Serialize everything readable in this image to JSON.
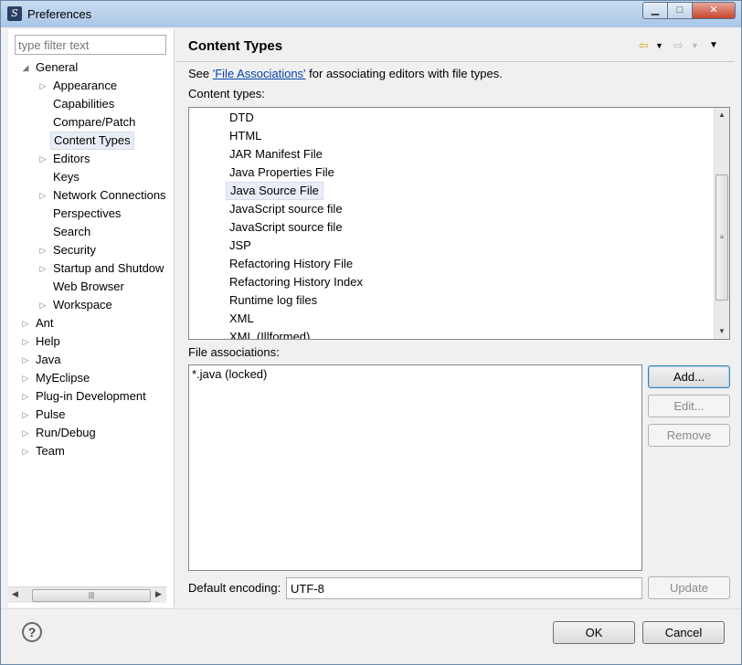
{
  "window": {
    "title": "Preferences"
  },
  "filter": {
    "placeholder": "type filter text"
  },
  "tree": [
    {
      "label": "General",
      "depth": 0,
      "expanded": true
    },
    {
      "label": "Appearance",
      "depth": 1,
      "hasChildren": true
    },
    {
      "label": "Capabilities",
      "depth": 1
    },
    {
      "label": "Compare/Patch",
      "depth": 1
    },
    {
      "label": "Content Types",
      "depth": 1,
      "selected": true
    },
    {
      "label": "Editors",
      "depth": 1,
      "hasChildren": true
    },
    {
      "label": "Keys",
      "depth": 1
    },
    {
      "label": "Network Connections",
      "depth": 1,
      "hasChildren": true
    },
    {
      "label": "Perspectives",
      "depth": 1
    },
    {
      "label": "Search",
      "depth": 1
    },
    {
      "label": "Security",
      "depth": 1,
      "hasChildren": true
    },
    {
      "label": "Startup and Shutdow",
      "depth": 1,
      "hasChildren": true
    },
    {
      "label": "Web Browser",
      "depth": 1
    },
    {
      "label": "Workspace",
      "depth": 1,
      "hasChildren": true
    },
    {
      "label": "Ant",
      "depth": 0,
      "hasChildren": true
    },
    {
      "label": "Help",
      "depth": 0,
      "hasChildren": true
    },
    {
      "label": "Java",
      "depth": 0,
      "hasChildren": true
    },
    {
      "label": "MyEclipse",
      "depth": 0,
      "hasChildren": true
    },
    {
      "label": "Plug-in Development",
      "depth": 0,
      "hasChildren": true
    },
    {
      "label": "Pulse",
      "depth": 0,
      "hasChildren": true
    },
    {
      "label": "Run/Debug",
      "depth": 0,
      "hasChildren": true
    },
    {
      "label": "Team",
      "depth": 0,
      "hasChildren": true
    }
  ],
  "page": {
    "title": "Content Types",
    "info_prefix": "See ",
    "info_link": "'File Associations'",
    "info_suffix": " for associating editors with file types.",
    "content_types_label": "Content types:",
    "content_types": [
      "DTD",
      "HTML",
      "JAR Manifest File",
      "Java Properties File",
      "Java Source File",
      "JavaScript source file",
      "JavaScript source file",
      "JSP",
      "Refactoring History File",
      "Refactoring History Index",
      "Runtime log files",
      "XML",
      "XML (Illformed)"
    ],
    "selected_content_type": "Java Source File",
    "file_associations_label": "File associations:",
    "file_associations": [
      "*.java (locked)"
    ],
    "buttons": {
      "add": "Add...",
      "edit": "Edit...",
      "remove": "Remove",
      "update": "Update"
    },
    "encoding_label": "Default encoding:",
    "encoding_value": "UTF-8"
  },
  "footer": {
    "ok": "OK",
    "cancel": "Cancel"
  },
  "icons": {
    "back": "back-arrow-icon",
    "forward": "forward-arrow-icon",
    "menu": "view-menu-icon",
    "help": "help-icon"
  },
  "colors": {
    "selection": "#e9eef6",
    "link": "#0645ad"
  }
}
